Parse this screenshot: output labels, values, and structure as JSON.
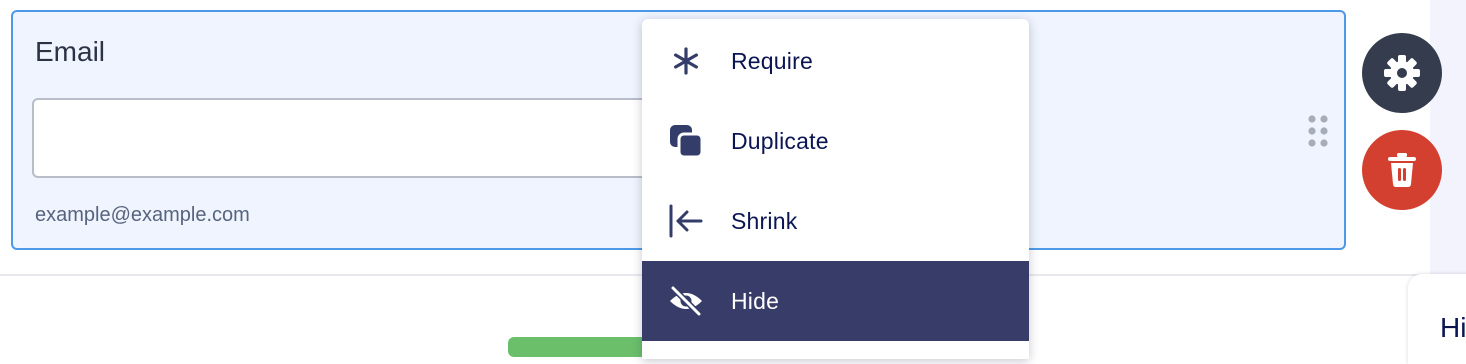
{
  "field": {
    "label": "Email",
    "input_value": "",
    "hint": "example@example.com"
  },
  "context_menu": {
    "items": [
      {
        "label": "Require",
        "icon": "asterisk-icon"
      },
      {
        "label": "Duplicate",
        "icon": "duplicate-icon"
      },
      {
        "label": "Shrink",
        "icon": "shrink-icon"
      },
      {
        "label": "Hide",
        "icon": "eye-off-icon",
        "active": true
      }
    ]
  },
  "actions": {
    "settings_icon": "gear-icon",
    "delete_icon": "trash-icon"
  },
  "side_panel": {
    "text_fragment": "Hi"
  },
  "colors": {
    "field_border": "#4d99e8",
    "field_bg": "#eff4fe",
    "menu_active_bg": "#373c68",
    "menu_text": "#0a1551",
    "settings_btn": "#343c4e",
    "delete_btn": "#d4402f"
  }
}
